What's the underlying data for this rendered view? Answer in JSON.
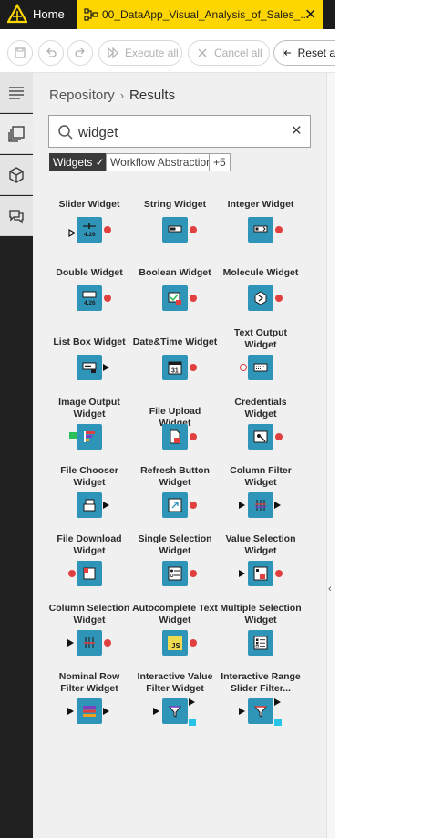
{
  "tabs": {
    "home_label": "Home",
    "workflow_label": "00_DataApp_Visual_Analysis_of_Sales_...",
    "close_glyph": "✕"
  },
  "toolbar": {
    "execute_all": "Execute all",
    "cancel_all": "Cancel all",
    "reset_all": "Reset a"
  },
  "breadcrumb": {
    "root": "Repository",
    "separator": "›",
    "current": "Results"
  },
  "search": {
    "value": "widget",
    "clear_glyph": "✕"
  },
  "tags": {
    "selected": "Widgets ✓",
    "option": "Workflow Abstraction",
    "more": "+5"
  },
  "nodes": [
    {
      "title": "Slider Widget",
      "icon": "slider-icon"
    },
    {
      "title": "String Widget",
      "icon": "string-icon"
    },
    {
      "title": "Integer Widget",
      "icon": "integer-icon"
    },
    {
      "title": "Double Widget",
      "icon": "double-icon"
    },
    {
      "title": "Boolean Widget",
      "icon": "boolean-icon"
    },
    {
      "title": "Molecule Widget",
      "icon": "molecule-icon"
    },
    {
      "title": "List Box Widget",
      "icon": "list-box-icon"
    },
    {
      "title": "Date&Time Widget",
      "icon": "calendar-icon"
    },
    {
      "title": "Text Output Widget",
      "icon": "text-output-icon"
    },
    {
      "title": "Image Output Widget",
      "icon": "image-output-icon"
    },
    {
      "title": "File Upload Widget",
      "icon": "file-upload-icon"
    },
    {
      "title": "Credentials Widget",
      "icon": "credentials-icon"
    },
    {
      "title": "File Chooser Widget",
      "icon": "file-chooser-icon"
    },
    {
      "title": "Refresh Button Widget",
      "icon": "refresh-button-icon"
    },
    {
      "title": "Column Filter Widget",
      "icon": "column-filter-icon"
    },
    {
      "title": "File Download Widget",
      "icon": "file-download-icon"
    },
    {
      "title": "Single Selection Widget",
      "icon": "single-selection-icon"
    },
    {
      "title": "Value Selection Widget",
      "icon": "value-selection-icon"
    },
    {
      "title": "Column Selection Widget",
      "icon": "column-selection-icon"
    },
    {
      "title": "Autocomplete Text Widget",
      "icon": "js-icon"
    },
    {
      "title": "Multiple Selection Widget",
      "icon": "multiple-selection-icon"
    },
    {
      "title": "Nominal Row Filter Widget",
      "icon": "nominal-row-filter-icon"
    },
    {
      "title": "Interactive Value Filter Widget",
      "icon": "interactive-value-filter-icon"
    },
    {
      "title": "Interactive Range Slider Filter...",
      "icon": "interactive-range-slider-icon"
    }
  ],
  "slider_value_label": "4.26",
  "double_value_label": "4.26",
  "js_label": "JS",
  "calendar_label": "31",
  "colors": {
    "node_blue": "#2f95b8",
    "port_red": "#e0403f",
    "tab_yellow": "#fdd600",
    "sidebar_dark": "#212121"
  }
}
